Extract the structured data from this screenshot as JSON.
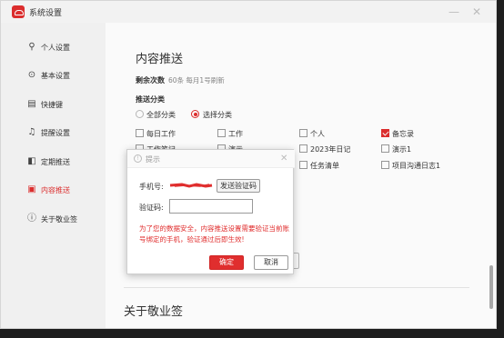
{
  "window": {
    "title": "系统设置",
    "logo_icon": "cloud-logo-icon",
    "accent_color": "#e02e2e",
    "minimize_glyph": "—",
    "close_glyph": "✕"
  },
  "sidebar": {
    "items": [
      {
        "label": "个人设置",
        "icon": "user-icon",
        "glyph": "⚲",
        "active": false
      },
      {
        "label": "基本设置",
        "icon": "settings-icon",
        "glyph": "⊙",
        "active": false
      },
      {
        "label": "快捷键",
        "icon": "keyboard-icon",
        "glyph": "▤",
        "active": false
      },
      {
        "label": "提醒设置",
        "icon": "bell-icon",
        "glyph": "♫",
        "active": false
      },
      {
        "label": "定期推送",
        "icon": "calendar-icon",
        "glyph": "◧",
        "active": false
      },
      {
        "label": "内容推送",
        "icon": "push-icon",
        "glyph": "▣",
        "active": true
      },
      {
        "label": "关于敬业签",
        "icon": "info-icon",
        "glyph": "ⓘ",
        "active": false
      }
    ]
  },
  "content_push": {
    "title": "内容推送",
    "remaining_label": "剩余次数",
    "remaining_value": "60条 每月1号刷新",
    "category_label": "推送分类",
    "radios": [
      {
        "label": "全部分类",
        "checked": false
      },
      {
        "label": "选择分类",
        "checked": true
      }
    ],
    "categories": [
      {
        "label": "每日工作",
        "checked": false
      },
      {
        "label": "工作",
        "checked": false
      },
      {
        "label": "个人",
        "checked": false
      },
      {
        "label": "备忘录",
        "checked": true
      },
      {
        "label": "工作笔记",
        "checked": false
      },
      {
        "label": "演示",
        "checked": false
      },
      {
        "label": "2023年日记",
        "checked": false
      },
      {
        "label": "演示1",
        "checked": false
      },
      {
        "label": "",
        "checked": false
      },
      {
        "label": "",
        "checked": false
      },
      {
        "label": "任务清单",
        "checked": false
      },
      {
        "label": "项目沟通日志1",
        "checked": false
      }
    ]
  },
  "about": {
    "title": "关于敬业签"
  },
  "dialog": {
    "title": "提示",
    "phone_label": "手机号:",
    "phone_value": "",
    "send_code_label": "发送验证码",
    "code_label": "验证码:",
    "code_value": "",
    "code_placeholder": "",
    "warning": "为了您的数据安全，内容推送设置需要验证当前账号绑定的手机，验证通过后即生效!",
    "ok_label": "确定",
    "cancel_label": "取消"
  }
}
